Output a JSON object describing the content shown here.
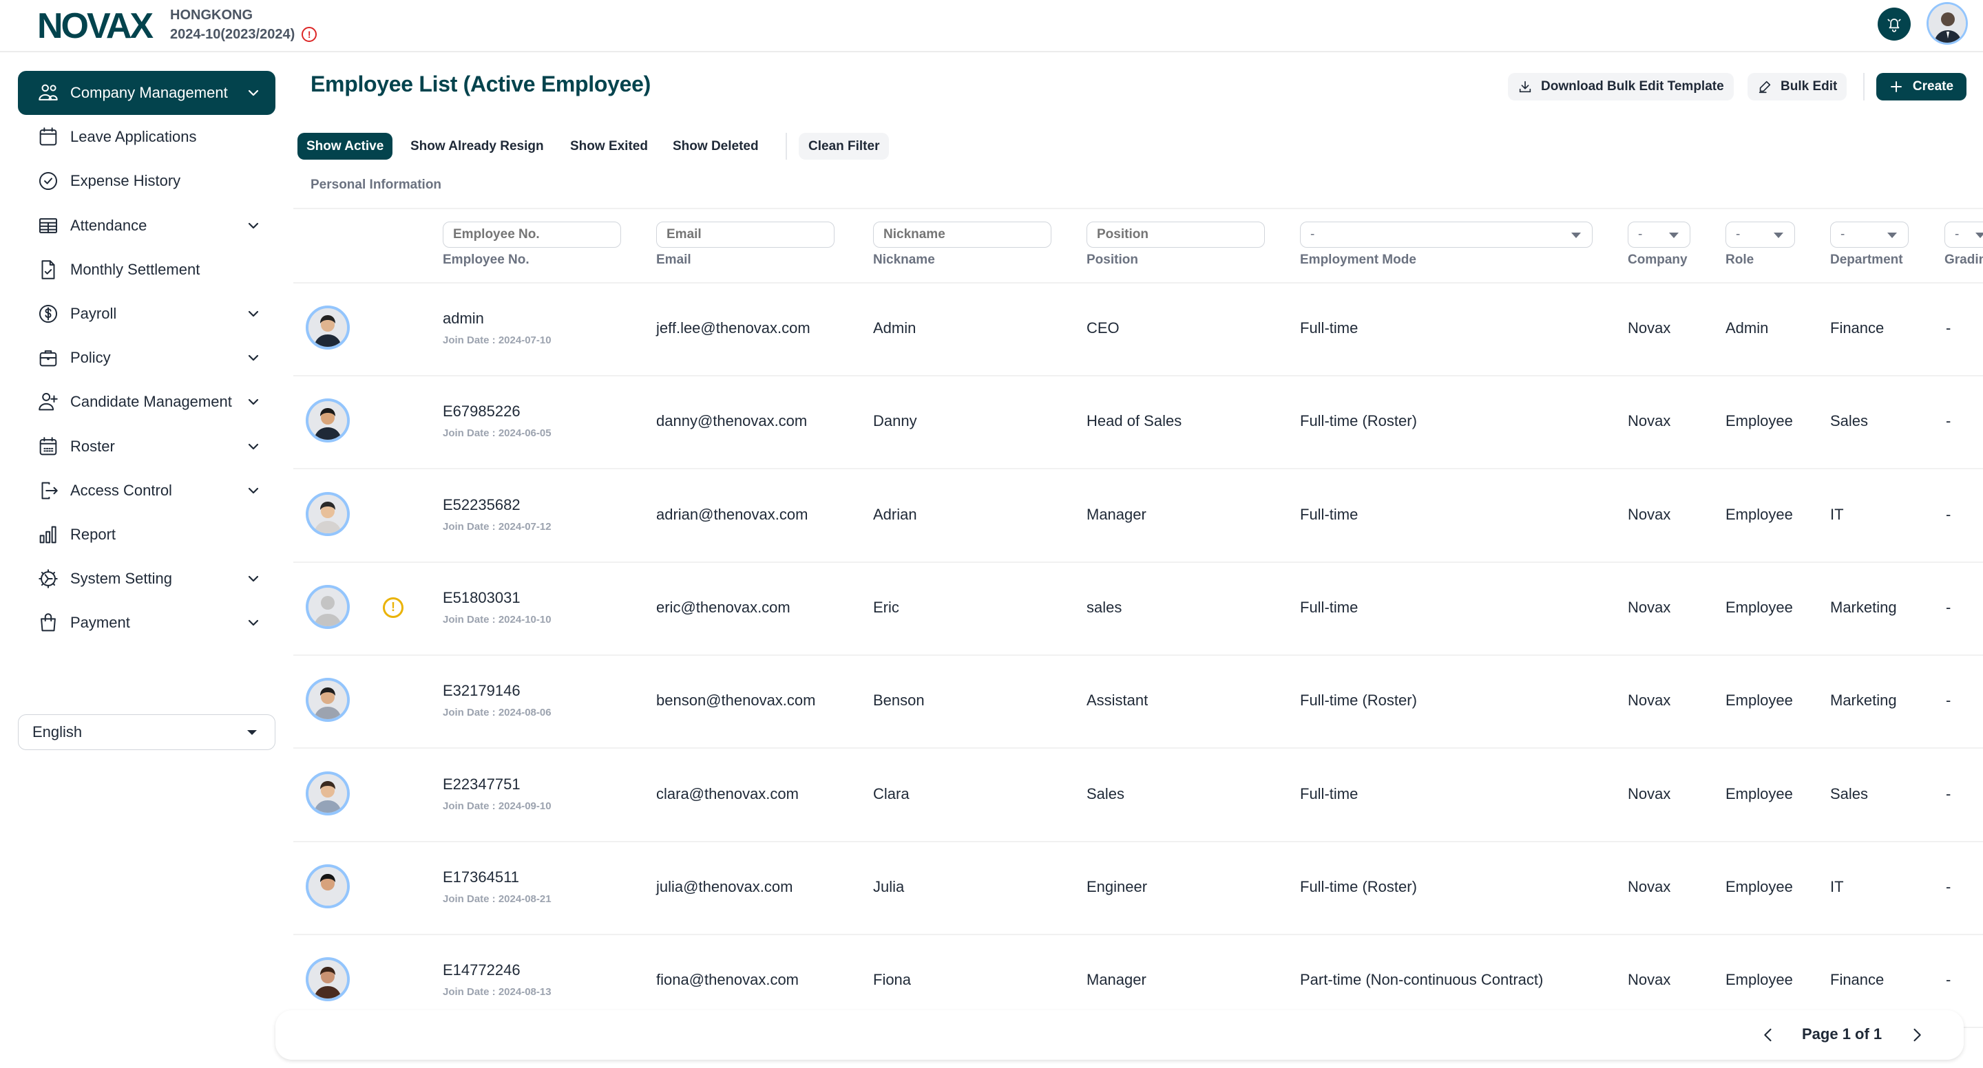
{
  "header": {
    "logo": "NOVAX",
    "region": "HONGKONG",
    "period": "2024-10(2023/2024)",
    "period_warning_icon": "alert-circle-icon",
    "notification_icon": "bell-icon",
    "user_avatar": "user-avatar"
  },
  "colors": {
    "brand": "#03434d",
    "warning": "#eab308",
    "error": "#dc2626",
    "avatar_ring": "#93c5fd"
  },
  "sidebar": {
    "items": [
      {
        "label": "Company Management",
        "icon": "users-icon",
        "has_chevron": true,
        "active": true
      },
      {
        "label": "Leave Applications",
        "icon": "calendar-icon",
        "has_chevron": false
      },
      {
        "label": "Expense History",
        "icon": "check-circle-icon",
        "has_chevron": false
      },
      {
        "label": "Attendance",
        "icon": "table-icon",
        "has_chevron": true
      },
      {
        "label": "Monthly Settlement",
        "icon": "document-check-icon",
        "has_chevron": false
      },
      {
        "label": "Payroll",
        "icon": "dollar-circle-icon",
        "has_chevron": true
      },
      {
        "label": "Policy",
        "icon": "briefcase-icon",
        "has_chevron": true
      },
      {
        "label": "Candidate Management",
        "icon": "user-plus-icon",
        "has_chevron": true
      },
      {
        "label": "Roster",
        "icon": "calendar-grid-icon",
        "has_chevron": true
      },
      {
        "label": "Access Control",
        "icon": "logout-icon",
        "has_chevron": true
      },
      {
        "label": "Report",
        "icon": "bar-chart-icon",
        "has_chevron": false
      },
      {
        "label": "System Setting",
        "icon": "settings-icon",
        "has_chevron": true
      },
      {
        "label": "Payment",
        "icon": "shopping-bag-icon",
        "has_chevron": true
      }
    ],
    "language": "English"
  },
  "main": {
    "title": "Employee List (Active Employee)",
    "toolbar": {
      "download_template": "Download Bulk Edit Template",
      "bulk_edit": "Bulk Edit",
      "create": "Create"
    },
    "filter_tabs": [
      "Show Active",
      "Show Already Resign",
      "Show Exited",
      "Show Deleted"
    ],
    "active_tab": "Show Active",
    "clean_filter": "Clean Filter",
    "section_label": "Personal Information",
    "filters": {
      "employee_no_placeholder": "Employee No.",
      "email_placeholder": "Email",
      "nickname_placeholder": "Nickname",
      "position_placeholder": "Position",
      "employment_mode_value": "-",
      "company_value": "-",
      "role_value": "-",
      "department_value": "-",
      "grading_value": "-"
    },
    "columns": [
      "Employee No.",
      "Email",
      "Nickname",
      "Position",
      "Employment Mode",
      "Company",
      "Role",
      "Department",
      "Grading"
    ],
    "join_date_prefix": "Join Date : ",
    "rows": [
      {
        "employee_no": "admin",
        "join_date": "Join Date : 2024-07-10",
        "email": "jeff.lee@thenovax.com",
        "nickname": "Admin",
        "position": "CEO",
        "employment_mode": "Full-time",
        "company": "Novax",
        "role": "Admin",
        "department": "Finance",
        "grading": "-",
        "warning": false,
        "avatar": "photo"
      },
      {
        "employee_no": "E67985226",
        "join_date": "Join Date : 2024-06-05",
        "email": "danny@thenovax.com",
        "nickname": "Danny",
        "position": "Head of Sales",
        "employment_mode": "Full-time (Roster)",
        "company": "Novax",
        "role": "Employee",
        "department": "Sales",
        "grading": "-",
        "warning": false,
        "avatar": "photo"
      },
      {
        "employee_no": "E52235682",
        "join_date": "Join Date : 2024-07-12",
        "email": "adrian@thenovax.com",
        "nickname": "Adrian",
        "position": "Manager",
        "employment_mode": "Full-time",
        "company": "Novax",
        "role": "Employee",
        "department": "IT",
        "grading": "-",
        "warning": false,
        "avatar": "photo"
      },
      {
        "employee_no": "E51803031",
        "join_date": "Join Date : 2024-10-10",
        "email": "eric@thenovax.com",
        "nickname": "Eric",
        "position": "sales",
        "employment_mode": "Full-time",
        "company": "Novax",
        "role": "Employee",
        "department": "Marketing",
        "grading": "-",
        "warning": true,
        "avatar": "placeholder"
      },
      {
        "employee_no": "E32179146",
        "join_date": "Join Date : 2024-08-06",
        "email": "benson@thenovax.com",
        "nickname": "Benson",
        "position": "Assistant",
        "employment_mode": "Full-time (Roster)",
        "company": "Novax",
        "role": "Employee",
        "department": "Marketing",
        "grading": "-",
        "warning": false,
        "avatar": "photo"
      },
      {
        "employee_no": "E22347751",
        "join_date": "Join Date : 2024-09-10",
        "email": "clara@thenovax.com",
        "nickname": "Clara",
        "position": "Sales",
        "employment_mode": "Full-time",
        "company": "Novax",
        "role": "Employee",
        "department": "Sales",
        "grading": "-",
        "warning": false,
        "avatar": "photo"
      },
      {
        "employee_no": "E17364511",
        "join_date": "Join Date : 2024-08-21",
        "email": "julia@thenovax.com",
        "nickname": "Julia",
        "position": "Engineer",
        "employment_mode": "Full-time (Roster)",
        "company": "Novax",
        "role": "Employee",
        "department": "IT",
        "grading": "-",
        "warning": false,
        "avatar": "photo"
      },
      {
        "employee_no": "E14772246",
        "join_date": "Join Date : 2024-08-13",
        "email": "fiona@thenovax.com",
        "nickname": "Fiona",
        "position": "Manager",
        "employment_mode": "Part-time (Non-continuous Contract)",
        "company": "Novax",
        "role": "Employee",
        "department": "Finance",
        "grading": "-",
        "warning": false,
        "avatar": "photo"
      }
    ],
    "pagination": {
      "label": "Page 1 of 1",
      "current": 1,
      "total": 1
    }
  }
}
